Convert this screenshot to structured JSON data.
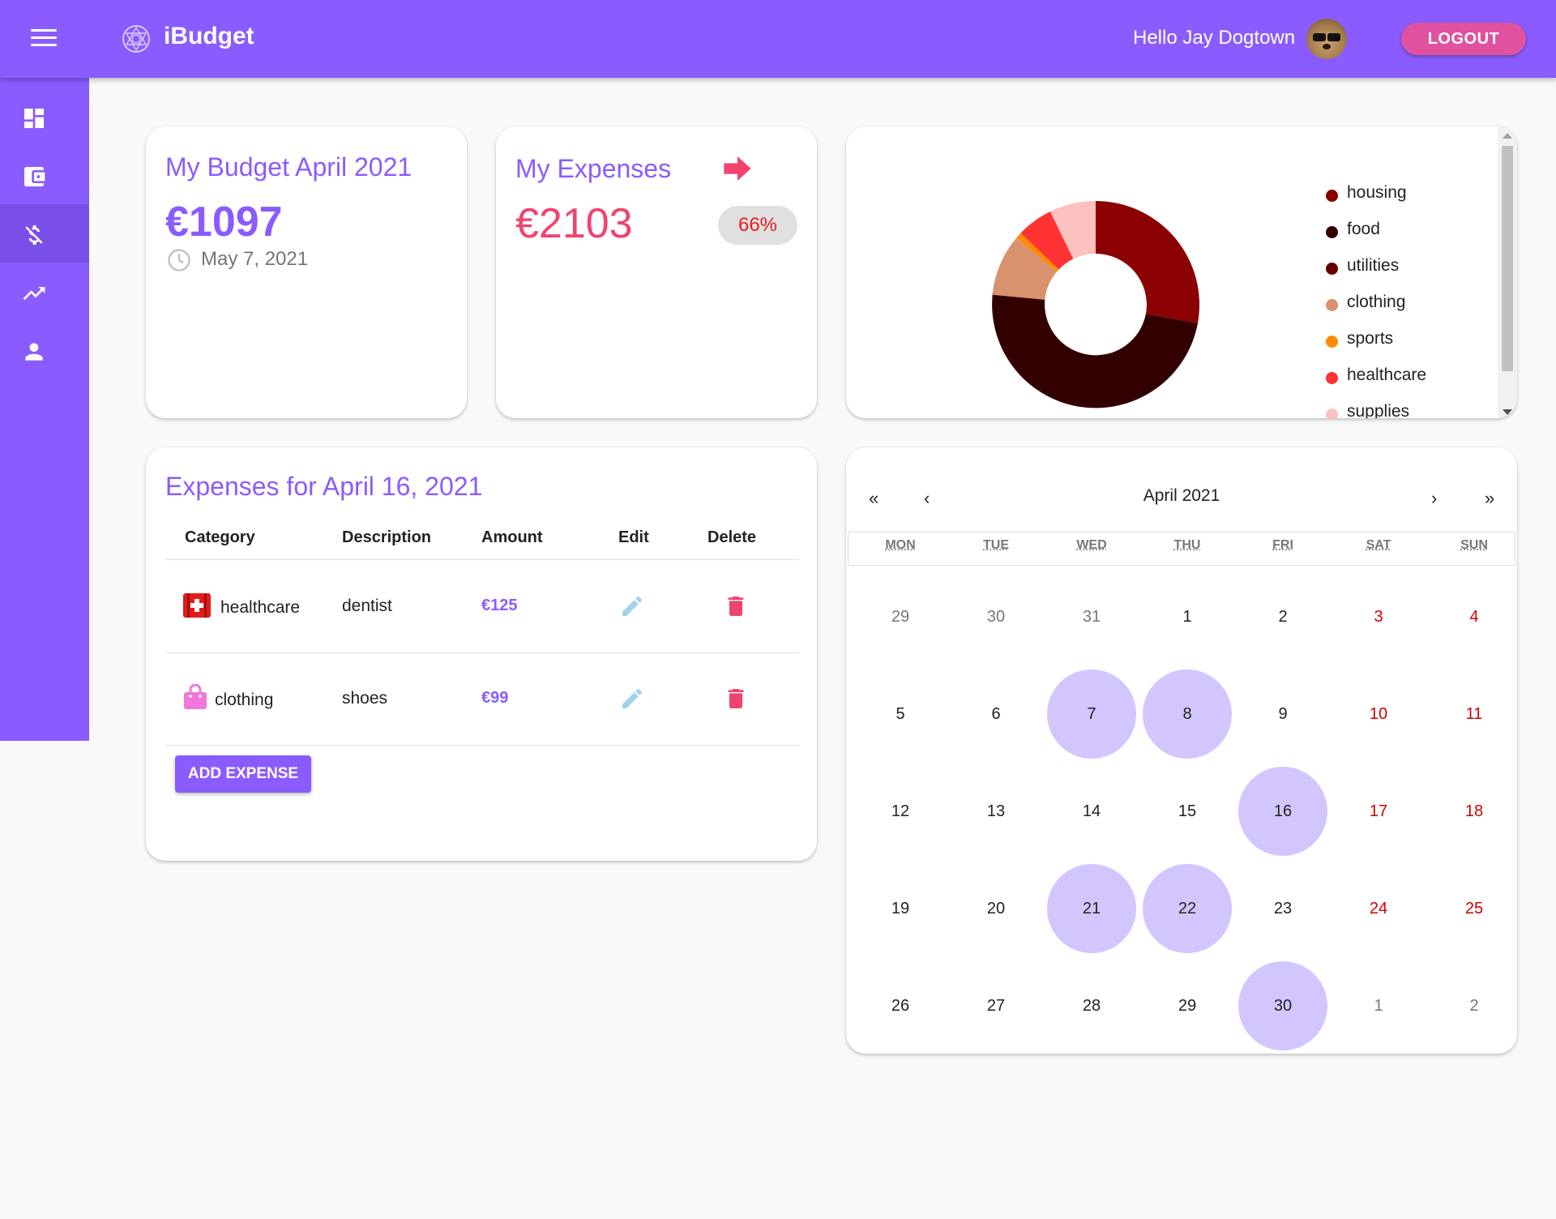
{
  "app": {
    "name": "iBudget",
    "greeting": "Hello Jay Dogtown",
    "logout_label": "LOGOUT",
    "accent": "#8a5cff"
  },
  "sidebar": {
    "items": [
      {
        "id": "dashboard",
        "icon": "dashboard-icon",
        "active": false
      },
      {
        "id": "wallet",
        "icon": "wallet-icon",
        "active": false
      },
      {
        "id": "expenses",
        "icon": "money-off-icon",
        "active": true
      },
      {
        "id": "trends",
        "icon": "trending-up-icon",
        "active": false
      },
      {
        "id": "profile",
        "icon": "person-icon",
        "active": false
      }
    ]
  },
  "budget_card": {
    "title": "My Budget April 2021",
    "amount": "€1097",
    "date": "May 7, 2021"
  },
  "expenses_card": {
    "title": "My Expenses",
    "amount": "€2103",
    "percent": "66%"
  },
  "pie": {
    "legend": [
      {
        "label": "housing",
        "color": "#8b0000"
      },
      {
        "label": "food",
        "color": "#330000"
      },
      {
        "label": "utilities",
        "color": "#660000"
      },
      {
        "label": "clothing",
        "color": "#d8926e"
      },
      {
        "label": "sports",
        "color": "#ff8c00"
      },
      {
        "label": "healthcare",
        "color": "#ff3333"
      },
      {
        "label": "supplies",
        "color": "#ffc0c0"
      }
    ]
  },
  "expenses_table": {
    "title": "Expenses for April 16, 2021",
    "headers": {
      "category": "Category",
      "description": "Description",
      "amount": "Amount",
      "edit": "Edit",
      "delete": "Delete"
    },
    "rows": [
      {
        "category": "healthcare",
        "description": "dentist",
        "amount": "€125"
      },
      {
        "category": "clothing",
        "description": "shoes",
        "amount": "€99"
      }
    ],
    "add_label": "ADD EXPENSE"
  },
  "calendar": {
    "month_label": "April 2021",
    "nav": {
      "prev_year": "«",
      "prev_month": "‹",
      "next_month": "›",
      "next_year": "»"
    },
    "weekdays": [
      "MON",
      "TUE",
      "WED",
      "THU",
      "FRI",
      "SAT",
      "SUN"
    ],
    "weeks": [
      [
        "29",
        "30",
        "31",
        "1",
        "2",
        "3",
        "4"
      ],
      [
        "5",
        "6",
        "7",
        "8",
        "9",
        "10",
        "11"
      ],
      [
        "12",
        "13",
        "14",
        "15",
        "16",
        "17",
        "18"
      ],
      [
        "19",
        "20",
        "21",
        "22",
        "23",
        "24",
        "25"
      ],
      [
        "26",
        "27",
        "28",
        "29",
        "30",
        "1",
        "2"
      ]
    ],
    "outside_month": [
      "0-0",
      "0-1",
      "0-2",
      "4-5",
      "4-6"
    ],
    "marked_days": [
      "7",
      "8",
      "16",
      "21",
      "22",
      "30"
    ]
  }
}
